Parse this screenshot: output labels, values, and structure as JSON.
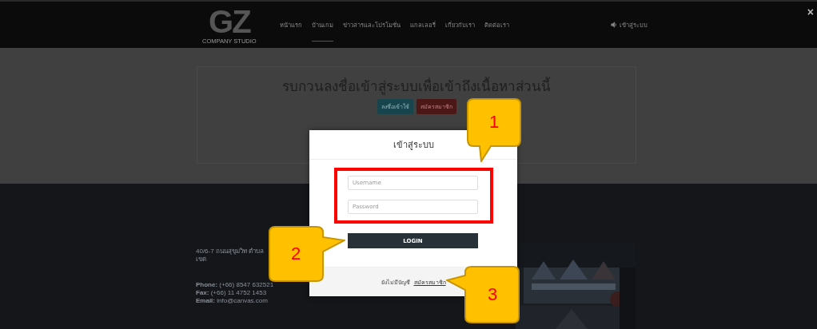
{
  "nav": {
    "logo": "GZ",
    "logo_subtitle": "COMPANY STUDIO",
    "items": [
      {
        "label": "หน้าแรก",
        "selected": false
      },
      {
        "label": "บ้านเกม",
        "selected": true
      },
      {
        "label": "ข่าวสารและโปรโมชั่น",
        "selected": false
      },
      {
        "label": "แกลเลอรี่",
        "selected": false
      },
      {
        "label": "เกี่ยวกับเรา",
        "selected": false
      },
      {
        "label": "ติดต่อเรา",
        "selected": false
      }
    ],
    "login_link": "เข้าสู่ระบบ"
  },
  "close_button": "×",
  "notice": {
    "title": "รบกวนลงชื่อเข้าสู่ระบบเพื่อเข้าถึงเนื้อหาส่วนนี้",
    "buttons": [
      {
        "label": "ลงชื่อเข้าใช้",
        "kind": "primary"
      },
      {
        "label": "สมัครสมาชิก",
        "kind": "danger"
      }
    ]
  },
  "footer": {
    "address": "40/6-7 ถนนสุขุมวิท ตำบล",
    "address_2": "เขต",
    "contacts": [
      {
        "label": "Phone:",
        "value": "(+66) 8547 632521"
      },
      {
        "label": "Fax:",
        "value": "(+66) 11 4752 1453"
      },
      {
        "label": "Email:",
        "value": "info@canvas.com"
      }
    ]
  },
  "modal": {
    "title": "เข้าสู่ระบบ",
    "fields": [
      {
        "placeholder": "Username"
      },
      {
        "placeholder": "Password"
      }
    ],
    "submit": "LOGIN",
    "footer_text": "ยังไม่มีบัญชี",
    "footer_link": "สมัครสมาชิก"
  },
  "callouts": [
    {
      "number": "1"
    },
    {
      "number": "2"
    },
    {
      "number": "3"
    }
  ]
}
